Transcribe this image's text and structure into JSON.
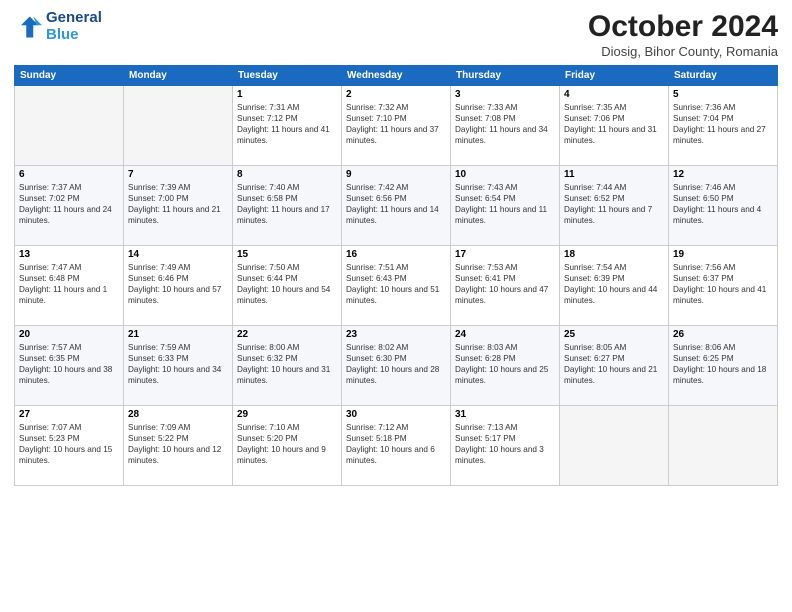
{
  "header": {
    "logo_line1": "General",
    "logo_line2": "Blue",
    "month": "October 2024",
    "location": "Diosig, Bihor County, Romania"
  },
  "weekdays": [
    "Sunday",
    "Monday",
    "Tuesday",
    "Wednesday",
    "Thursday",
    "Friday",
    "Saturday"
  ],
  "weeks": [
    [
      {
        "day": "",
        "empty": true
      },
      {
        "day": "",
        "empty": true
      },
      {
        "day": "1",
        "sunrise": "7:31 AM",
        "sunset": "7:12 PM",
        "daylight": "11 hours and 41 minutes."
      },
      {
        "day": "2",
        "sunrise": "7:32 AM",
        "sunset": "7:10 PM",
        "daylight": "11 hours and 37 minutes."
      },
      {
        "day": "3",
        "sunrise": "7:33 AM",
        "sunset": "7:08 PM",
        "daylight": "11 hours and 34 minutes."
      },
      {
        "day": "4",
        "sunrise": "7:35 AM",
        "sunset": "7:06 PM",
        "daylight": "11 hours and 31 minutes."
      },
      {
        "day": "5",
        "sunrise": "7:36 AM",
        "sunset": "7:04 PM",
        "daylight": "11 hours and 27 minutes."
      }
    ],
    [
      {
        "day": "6",
        "sunrise": "7:37 AM",
        "sunset": "7:02 PM",
        "daylight": "11 hours and 24 minutes."
      },
      {
        "day": "7",
        "sunrise": "7:39 AM",
        "sunset": "7:00 PM",
        "daylight": "11 hours and 21 minutes."
      },
      {
        "day": "8",
        "sunrise": "7:40 AM",
        "sunset": "6:58 PM",
        "daylight": "11 hours and 17 minutes."
      },
      {
        "day": "9",
        "sunrise": "7:42 AM",
        "sunset": "6:56 PM",
        "daylight": "11 hours and 14 minutes."
      },
      {
        "day": "10",
        "sunrise": "7:43 AM",
        "sunset": "6:54 PM",
        "daylight": "11 hours and 11 minutes."
      },
      {
        "day": "11",
        "sunrise": "7:44 AM",
        "sunset": "6:52 PM",
        "daylight": "11 hours and 7 minutes."
      },
      {
        "day": "12",
        "sunrise": "7:46 AM",
        "sunset": "6:50 PM",
        "daylight": "11 hours and 4 minutes."
      }
    ],
    [
      {
        "day": "13",
        "sunrise": "7:47 AM",
        "sunset": "6:48 PM",
        "daylight": "11 hours and 1 minute."
      },
      {
        "day": "14",
        "sunrise": "7:49 AM",
        "sunset": "6:46 PM",
        "daylight": "10 hours and 57 minutes."
      },
      {
        "day": "15",
        "sunrise": "7:50 AM",
        "sunset": "6:44 PM",
        "daylight": "10 hours and 54 minutes."
      },
      {
        "day": "16",
        "sunrise": "7:51 AM",
        "sunset": "6:43 PM",
        "daylight": "10 hours and 51 minutes."
      },
      {
        "day": "17",
        "sunrise": "7:53 AM",
        "sunset": "6:41 PM",
        "daylight": "10 hours and 47 minutes."
      },
      {
        "day": "18",
        "sunrise": "7:54 AM",
        "sunset": "6:39 PM",
        "daylight": "10 hours and 44 minutes."
      },
      {
        "day": "19",
        "sunrise": "7:56 AM",
        "sunset": "6:37 PM",
        "daylight": "10 hours and 41 minutes."
      }
    ],
    [
      {
        "day": "20",
        "sunrise": "7:57 AM",
        "sunset": "6:35 PM",
        "daylight": "10 hours and 38 minutes."
      },
      {
        "day": "21",
        "sunrise": "7:59 AM",
        "sunset": "6:33 PM",
        "daylight": "10 hours and 34 minutes."
      },
      {
        "day": "22",
        "sunrise": "8:00 AM",
        "sunset": "6:32 PM",
        "daylight": "10 hours and 31 minutes."
      },
      {
        "day": "23",
        "sunrise": "8:02 AM",
        "sunset": "6:30 PM",
        "daylight": "10 hours and 28 minutes."
      },
      {
        "day": "24",
        "sunrise": "8:03 AM",
        "sunset": "6:28 PM",
        "daylight": "10 hours and 25 minutes."
      },
      {
        "day": "25",
        "sunrise": "8:05 AM",
        "sunset": "6:27 PM",
        "daylight": "10 hours and 21 minutes."
      },
      {
        "day": "26",
        "sunrise": "8:06 AM",
        "sunset": "6:25 PM",
        "daylight": "10 hours and 18 minutes."
      }
    ],
    [
      {
        "day": "27",
        "sunrise": "7:07 AM",
        "sunset": "5:23 PM",
        "daylight": "10 hours and 15 minutes."
      },
      {
        "day": "28",
        "sunrise": "7:09 AM",
        "sunset": "5:22 PM",
        "daylight": "10 hours and 12 minutes."
      },
      {
        "day": "29",
        "sunrise": "7:10 AM",
        "sunset": "5:20 PM",
        "daylight": "10 hours and 9 minutes."
      },
      {
        "day": "30",
        "sunrise": "7:12 AM",
        "sunset": "5:18 PM",
        "daylight": "10 hours and 6 minutes."
      },
      {
        "day": "31",
        "sunrise": "7:13 AM",
        "sunset": "5:17 PM",
        "daylight": "10 hours and 3 minutes."
      },
      {
        "day": "",
        "empty": true
      },
      {
        "day": "",
        "empty": true
      }
    ]
  ]
}
